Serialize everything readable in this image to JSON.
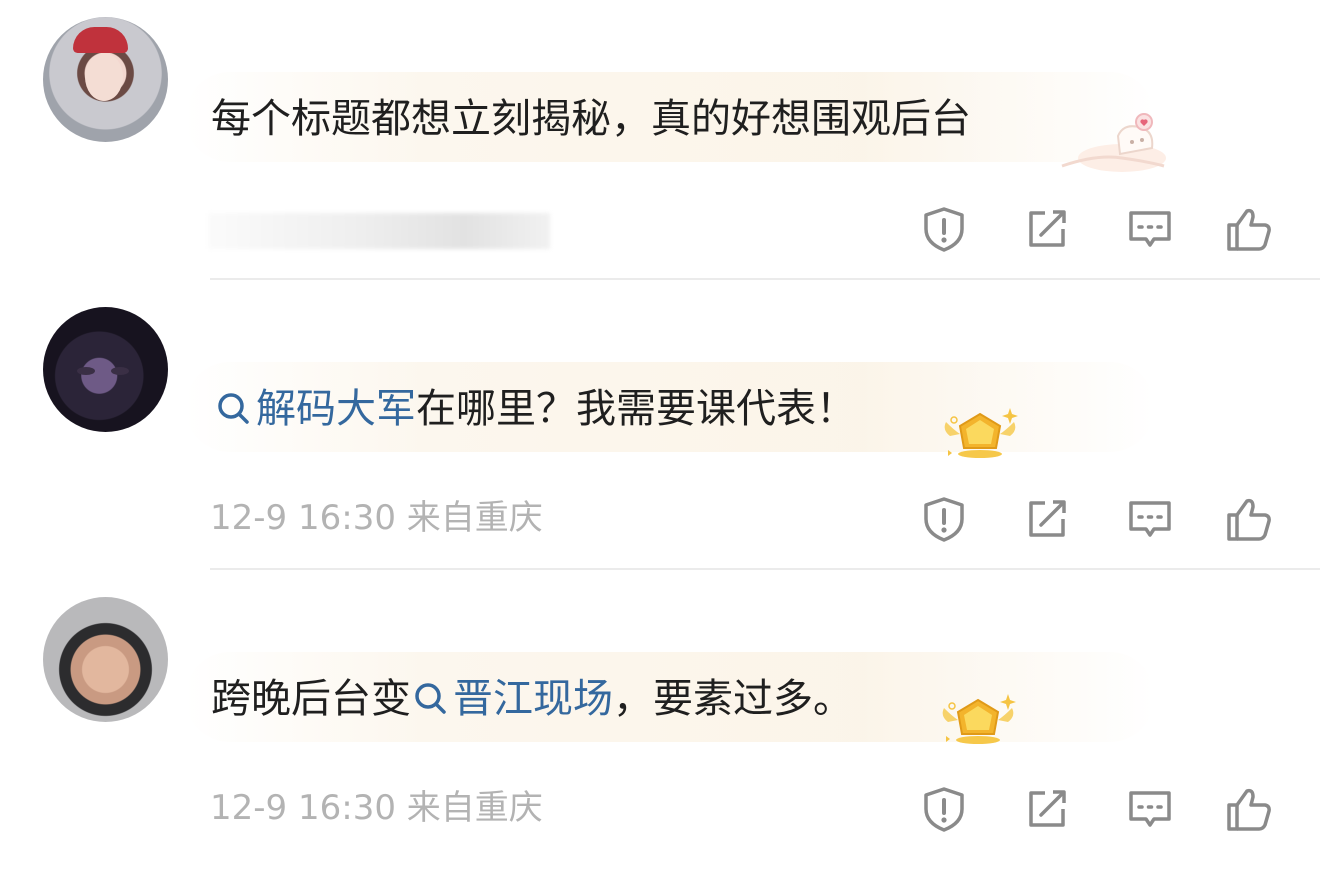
{
  "comments": [
    {
      "text_parts": [
        {
          "type": "text",
          "value": "每个标题都想立刻揭秘，真的好想围观后台"
        }
      ],
      "meta": "",
      "badge_icon": "cat-sticker-icon",
      "actions": {
        "report_icon": "shield-alert-icon",
        "forward_icon": "share-edit-icon",
        "reply_icon": "comment-icon",
        "like_icon": "thumb-up-icon"
      }
    },
    {
      "text_parts": [
        {
          "type": "link",
          "value": "解码大军"
        },
        {
          "type": "text",
          "value": "在哪里？我需要课代表！"
        }
      ],
      "meta": "12-9 16:30 来自重庆",
      "badge_icon": "gold-crown-icon",
      "actions": {
        "report_icon": "shield-alert-icon",
        "forward_icon": "share-edit-icon",
        "reply_icon": "comment-icon",
        "like_icon": "thumb-up-icon"
      }
    },
    {
      "text_parts": [
        {
          "type": "text",
          "value": "跨晚后台变"
        },
        {
          "type": "link",
          "value": "晋江现场"
        },
        {
          "type": "text",
          "value": "，要素过多。"
        }
      ],
      "meta": "12-9 16:30 来自重庆",
      "badge_icon": "gold-crown-icon",
      "actions": {
        "report_icon": "shield-alert-icon",
        "forward_icon": "share-edit-icon",
        "reply_icon": "comment-icon",
        "like_icon": "thumb-up-icon"
      }
    }
  ],
  "colors": {
    "link": "#34689e",
    "meta": "#b3b3b3",
    "icon": "#8a8a8a"
  }
}
